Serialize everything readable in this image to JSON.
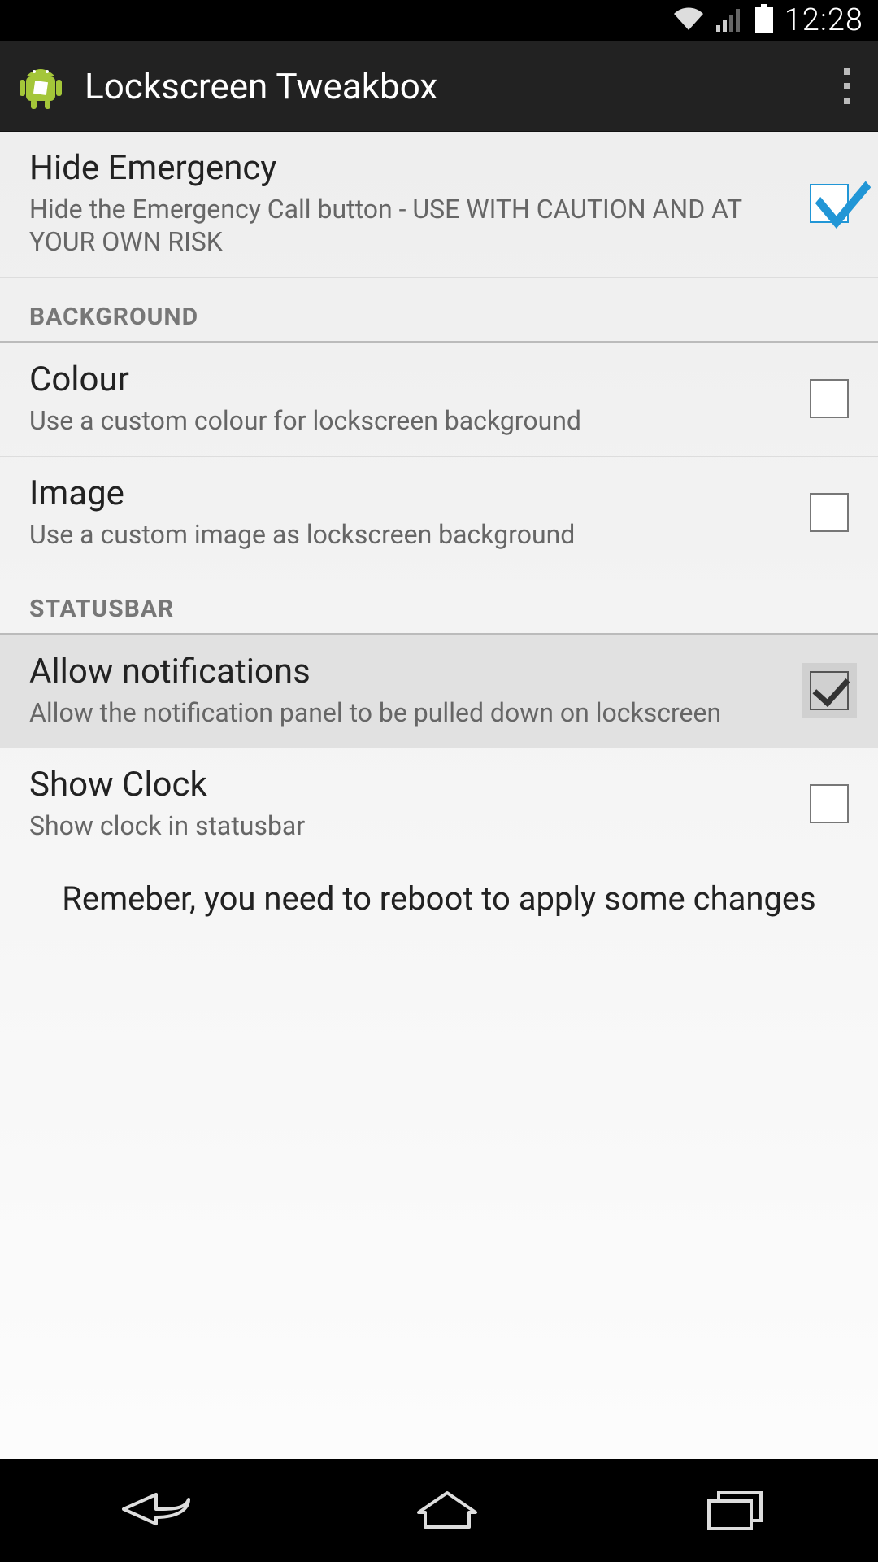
{
  "statusbar": {
    "time": "12:28"
  },
  "actionbar": {
    "title": "Lockscreen Tweakbox"
  },
  "sections": {
    "top": {
      "hide_emergency": {
        "title": "Hide Emergency",
        "summary": "Hide the Emergency Call button - USE WITH CAUTION AND AT YOUR OWN RISK",
        "checked": true
      }
    },
    "background": {
      "header": "BACKGROUND",
      "colour": {
        "title": "Colour",
        "summary": "Use a custom colour for lockscreen background",
        "checked": false
      },
      "image": {
        "title": "Image",
        "summary": "Use a custom image as lockscreen background",
        "checked": false
      }
    },
    "statusbar_section": {
      "header": "STATUSBAR",
      "allow_notifications": {
        "title": "Allow notifications",
        "summary": "Allow the notification panel to be pulled down on lockscreen",
        "checked": true
      },
      "show_clock": {
        "title": "Show Clock",
        "summary": "Show clock in statusbar",
        "checked": false
      }
    }
  },
  "footer": "Remeber, you need to reboot to apply some changes"
}
